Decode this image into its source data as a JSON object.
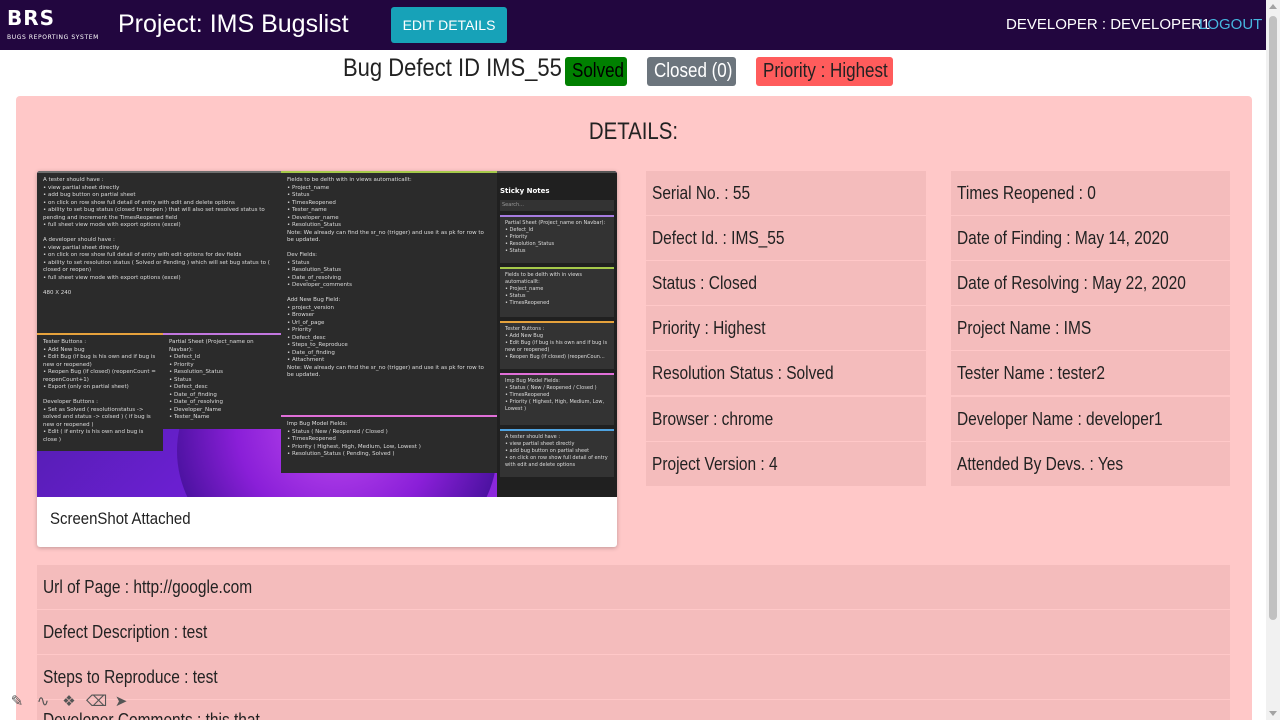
{
  "navbar": {
    "brand_main": "BRS",
    "brand_sub": "BUGS REPORTING SYSTEM",
    "project_title": "Project: IMS Bugslist",
    "edit_button": "EDIT DETAILS",
    "developer_label": "DEVELOPER : DEVELOPER1",
    "logout": "LOGOUT"
  },
  "bug": {
    "title": "Bug Defect ID IMS_55",
    "badges": {
      "solved": "Solved",
      "closed": "Closed (0)",
      "priority": "Priority : Highest"
    }
  },
  "details": {
    "heading": "DETAILS:",
    "screenshot_caption": "ScreenShot Attached",
    "left_column": [
      "Serial No. : 55",
      "Defect Id. : IMS_55",
      "Status : Closed",
      "Priority : Highest",
      "Resolution Status : Solved",
      "Browser : chrome",
      "Project Version : 4"
    ],
    "right_column": [
      "Times Reopened : 0",
      "Date of Finding : May 14, 2020",
      "Date of Resolving : May 22, 2020",
      "Project Name : IMS",
      "Tester Name : tester2",
      "Developer Name : developer1",
      "Attended By Devs. : Yes"
    ],
    "wide_rows": [
      "Url of Page : http://google.com",
      "Defect Description : test",
      "Steps to Reproduce : test",
      "Developer Comments : this that"
    ]
  },
  "screenshot_text": {
    "win1": "A tester should have :\n• view partial sheet directly\n• add bug button on partial sheet\n• on click on row show full detail of entry with edit and delete options\n• ability to set bug status (closed to reopen ) that will also set resolved status to pending and increment the TimesReopened field\n• full sheet view mode with export options (excel)\n\nA developer should have :\n• view partial sheet directly\n• on click on row show full detail of entry with edit options for dev fields\n• ability to set resolution status ( Solved or Pending ) which will set bug status to ( closed or reopen)\n• full sheet view mode with export options (excel)\n\n480 X 240",
    "win2": "Fields to be delth with in views automaticallt:\n• Project_name\n• Status\n• TimesReopened\n• Tester_name\n• Developer_name\n• Resolution_Status\nNote: We already can find the sr_no (trigger) and use it as pk for row to be updated.\n\nDev Fields:\n• Status\n• Resolution_Status\n• Date_of_resolving\n• Developer_comments\n\nAdd New Bug Field:\n• project_version\n• Browser\n• Url_of_page\n• Priority\n• Defect_desc\n• Steps_to_Reproduce\n• Date_of_finding\n• Attachment\nNote: We already can find the sr_no (trigger) and use it as pk for row to be updated.",
    "win3": "Tester Buttons :\n• Add New bug\n• Edit Bug (if bug is his own and if bug is new or reopened)\n• Reopen Bug (if closed) (reopenCount = reopenCount+1)\n• Export (only on partial sheet)\n\nDeveloper Buttons :\n• Set as Solved ( resolutionstatus -> solved and status -> colsed ) ( if bug is new or reopened )\n• Edit ( if entry is his own and bug is close )",
    "win4": "Partial Sheet (Project_name on Navbar):\n• Defect_Id\n• Priority\n• Resolution_Status\n• Status\n• Defect_desc\n• Date_of_finding\n• Date_of_resolving\n• Developer_Name\n• Tester_Name",
    "win5": "Imp Bug Model Fields:\n• Status ( New / Reopened / Closed )\n• TimesReopened\n• Priority ( Highest, High, Medium, Low, Lowest )\n• Resolution_Status ( Pending, Solved )",
    "sticky_title": "Sticky Notes",
    "sticky_search": "Search...",
    "notes": [
      "Partial Sheet (Project_name on Navbar):\n• Defect_Id\n• Priority\n• Resolution_Status\n• Status",
      "Fields to be delth with in views automaticallt:\n• Project_name\n• Status\n• TimesReopened",
      "Tester Buttons :\n• Add New Bug\n• Edit Bug (if bug is his own and if bug is new or reopened)\n• Reopen Bug (if closed) (reopenCoun...",
      "Imp Bug Model Fields:\n• Status ( New / Reopened / Closed )\n• TimesReopened\n• Priority ( Highest, High, Medium, Low, Lowest )",
      "A tester should have :\n• view partial sheet directly\n• add bug button on partial sheet\n• on click on row show full detail of entry with edit and delete options"
    ]
  },
  "colors": {
    "navbar": "#22063f",
    "accent": "#17a2b8",
    "panel": "#ffc8c8",
    "cell": "#f4bcbc"
  }
}
